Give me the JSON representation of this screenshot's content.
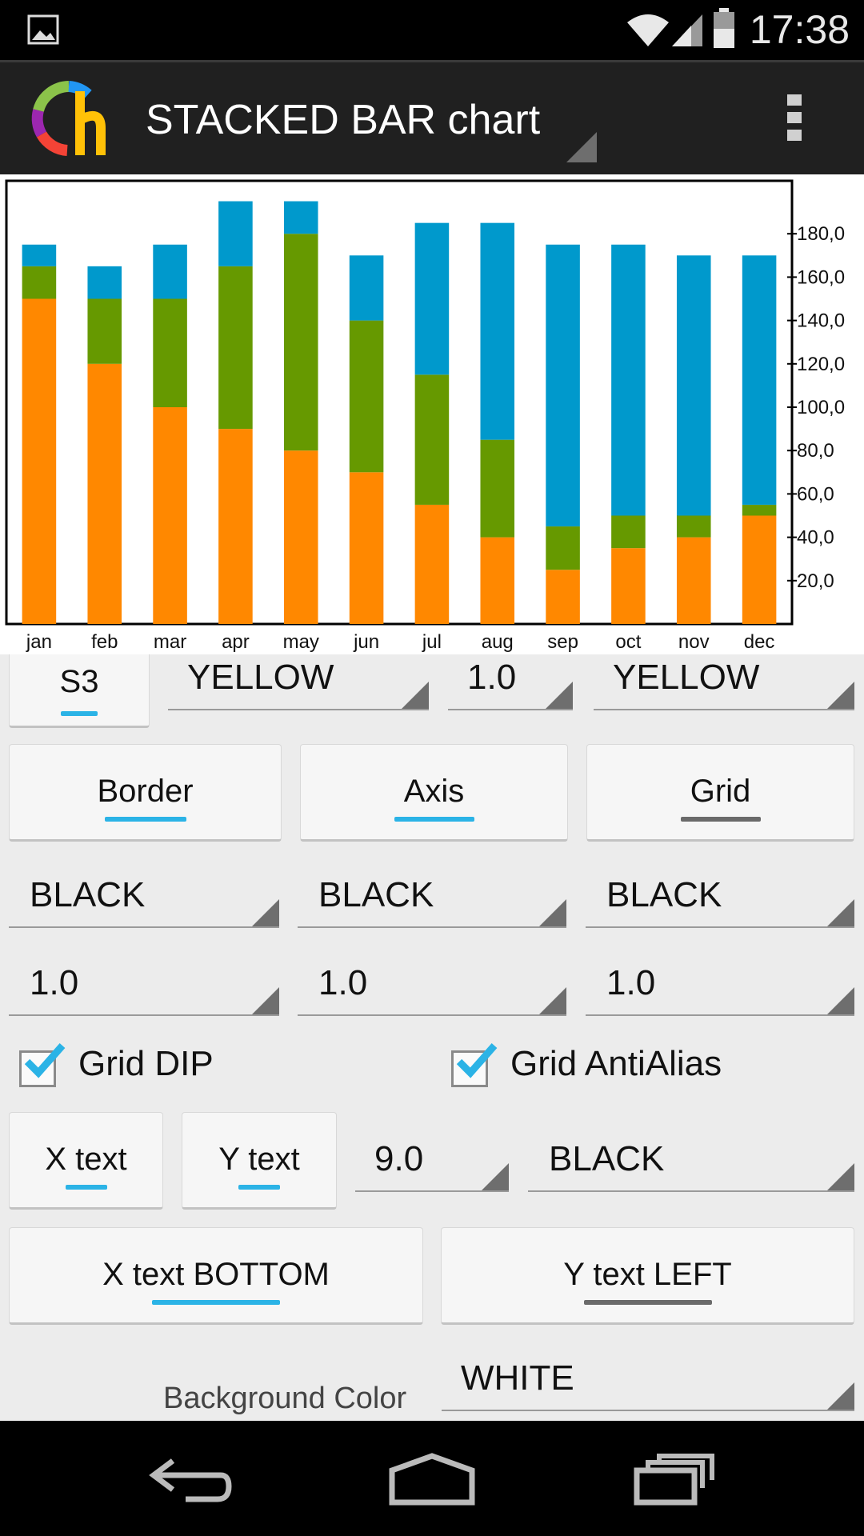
{
  "status_bar": {
    "time": "17:38"
  },
  "action_bar": {
    "title": "STACKED BAR chart",
    "overflow_icon": "overflow-menu-icon"
  },
  "chart_data": {
    "type": "bar",
    "stacked": true,
    "categories": [
      "jan",
      "feb",
      "mar",
      "apr",
      "may",
      "jun",
      "jul",
      "aug",
      "sep",
      "oct",
      "nov",
      "dec"
    ],
    "series": [
      {
        "color": "#ff8800",
        "values": [
          150,
          120,
          100,
          90,
          80,
          70,
          55,
          40,
          25,
          35,
          40,
          50
        ]
      },
      {
        "color": "#669900",
        "values": [
          15,
          30,
          50,
          75,
          100,
          70,
          60,
          45,
          20,
          15,
          10,
          5
        ]
      },
      {
        "color": "#0099cc",
        "values": [
          10,
          15,
          25,
          30,
          15,
          30,
          70,
          100,
          130,
          125,
          120,
          115
        ]
      }
    ],
    "yaxis_position": "right",
    "yticks": [
      "20,0",
      "40,0",
      "60,0",
      "80,0",
      "100,0",
      "120,0",
      "140,0",
      "160,0",
      "180,0"
    ],
    "ylim": [
      0,
      200
    ],
    "grid": false
  },
  "series_row": {
    "series_button": "S3",
    "color_value": "YELLOW",
    "width_value": "1.0",
    "color2_value": "YELLOW"
  },
  "toggles": {
    "border": "Border",
    "axis": "Axis",
    "grid": "Grid"
  },
  "colors_row": {
    "border_color": "BLACK",
    "axis_color": "BLACK",
    "grid_color": "BLACK"
  },
  "widths_row": {
    "border_width": "1.0",
    "axis_width": "1.0",
    "grid_width": "1.0"
  },
  "checkboxes": {
    "grid_dip": "Grid DIP",
    "grid_antialias": "Grid AntiAlias"
  },
  "text_row": {
    "x_text": "X text",
    "y_text": "Y text",
    "text_size": "9.0",
    "text_color": "BLACK"
  },
  "position_row": {
    "x_pos": "X text BOTTOM",
    "y_pos": "Y text LEFT"
  },
  "background": {
    "label": "Background Color",
    "value": "WHITE"
  }
}
